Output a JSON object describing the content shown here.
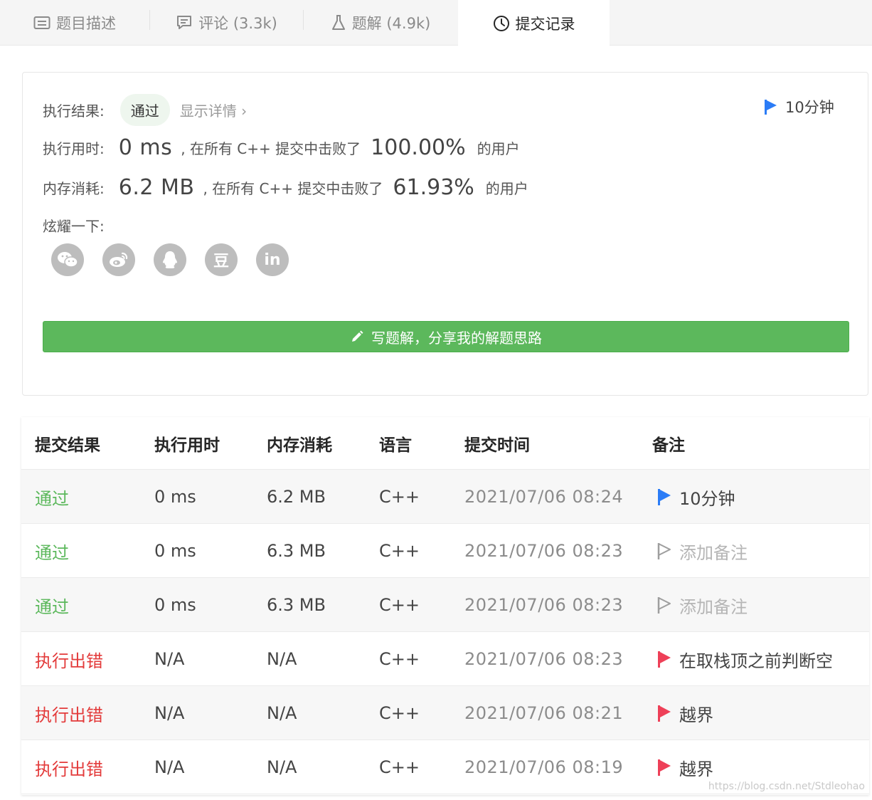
{
  "tabs": [
    {
      "label": "题目描述",
      "icon": "description-icon"
    },
    {
      "label": "评论 (3.3k)",
      "icon": "comment-icon"
    },
    {
      "label": "题解 (4.9k)",
      "icon": "flask-icon"
    },
    {
      "label": "提交记录",
      "icon": "clock-icon",
      "active": true
    }
  ],
  "result": {
    "status_label": "执行结果:",
    "status_value": "通过",
    "details_link": "显示详情 ›",
    "note": "10分钟",
    "runtime_label": "执行用时:",
    "runtime_value": "0 ms",
    "runtime_text": ", 在所有 C++ 提交中击败了",
    "runtime_percent": "100.00%",
    "runtime_suffix": "的用户",
    "memory_label": "内存消耗:",
    "memory_value": "6.2 MB",
    "memory_text": ", 在所有 C++ 提交中击败了",
    "memory_percent": "61.93%",
    "memory_suffix": "的用户",
    "share_label": "炫耀一下:",
    "share_icons": [
      "wechat-icon",
      "weibo-icon",
      "qq-icon",
      "douban-icon",
      "linkedin-icon"
    ],
    "share_glyphs": [
      "",
      "",
      "",
      "豆",
      "in"
    ],
    "write_button": "写题解，分享我的解题思路"
  },
  "table": {
    "headers": [
      "提交结果",
      "执行用时",
      "内存消耗",
      "语言",
      "提交时间",
      "备注"
    ],
    "rows": [
      {
        "status": "通过",
        "status_type": "ok",
        "runtime": "0 ms",
        "memory": "6.2 MB",
        "lang": "C++",
        "time": "2021/07/06 08:24",
        "note": "10分钟",
        "note_type": "blue"
      },
      {
        "status": "通过",
        "status_type": "ok",
        "runtime": "0 ms",
        "memory": "6.3 MB",
        "lang": "C++",
        "time": "2021/07/06 08:23",
        "note": "添加备注",
        "note_type": "empty"
      },
      {
        "status": "通过",
        "status_type": "ok",
        "runtime": "0 ms",
        "memory": "6.3 MB",
        "lang": "C++",
        "time": "2021/07/06 08:23",
        "note": "添加备注",
        "note_type": "empty"
      },
      {
        "status": "执行出错",
        "status_type": "err",
        "runtime": "N/A",
        "memory": "N/A",
        "lang": "C++",
        "time": "2021/07/06 08:23",
        "note": "在取栈顶之前判断空",
        "note_type": "red"
      },
      {
        "status": "执行出错",
        "status_type": "err",
        "runtime": "N/A",
        "memory": "N/A",
        "lang": "C++",
        "time": "2021/07/06 08:21",
        "note": "越界",
        "note_type": "red"
      },
      {
        "status": "执行出错",
        "status_type": "err",
        "runtime": "N/A",
        "memory": "N/A",
        "lang": "C++",
        "time": "2021/07/06 08:19",
        "note": "越界",
        "note_type": "red"
      }
    ]
  },
  "watermark": "https://blog.csdn.net/Stdleohao",
  "colors": {
    "accept_green": "#5cb85c",
    "error_red": "#e33b3b",
    "flag_blue": "#2b7cf6",
    "flag_red": "#ee4058",
    "flag_gray": "#9e9e9e"
  }
}
